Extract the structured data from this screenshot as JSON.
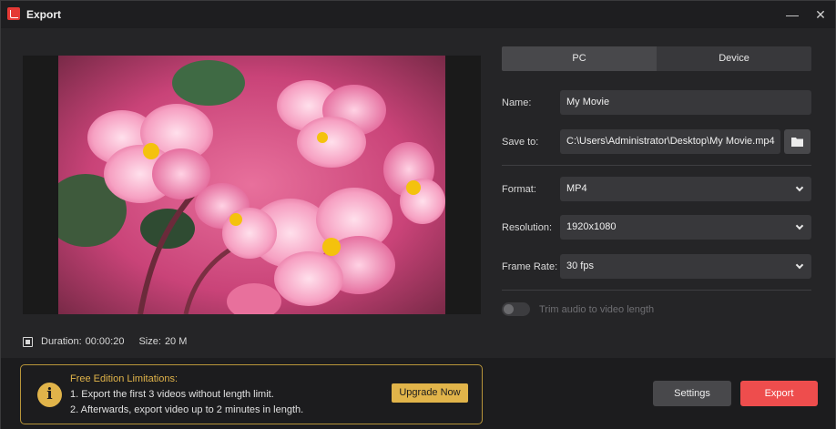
{
  "window": {
    "title": "Export",
    "minimize_glyph": "—",
    "close_glyph": "✕"
  },
  "info": {
    "duration_label": "Duration:",
    "duration_value": "00:00:20",
    "size_label": "Size:",
    "size_value": "20 M"
  },
  "tabs": [
    {
      "label": "PC",
      "active": true
    },
    {
      "label": "Device",
      "active": false
    }
  ],
  "form": {
    "name_label": "Name:",
    "name_value": "My Movie",
    "save_to_label": "Save to:",
    "save_to_value": "C:\\Users\\Administrator\\Desktop\\My Movie.mp4",
    "format_label": "Format:",
    "format_value": "MP4",
    "resolution_label": "Resolution:",
    "resolution_value": "1920x1080",
    "frame_rate_label": "Frame Rate:",
    "frame_rate_value": "30 fps",
    "trim_label": "Trim audio to video length",
    "trim_enabled": false
  },
  "limitations": {
    "title": "Free Edition Limitations:",
    "line1": "1. Export the first 3 videos without length limit.",
    "line2": "2. Afterwards, export video up to 2 minutes in length.",
    "upgrade_label": "Upgrade Now",
    "icon": "i"
  },
  "actions": {
    "settings_label": "Settings",
    "export_label": "Export"
  },
  "colors": {
    "accent_red": "#ee4d4d",
    "accent_gold": "#e1b44a"
  },
  "icons": {
    "folder": "folder-icon",
    "film": "film-icon",
    "chevron": "chevron-down-icon",
    "info": "info-icon"
  }
}
